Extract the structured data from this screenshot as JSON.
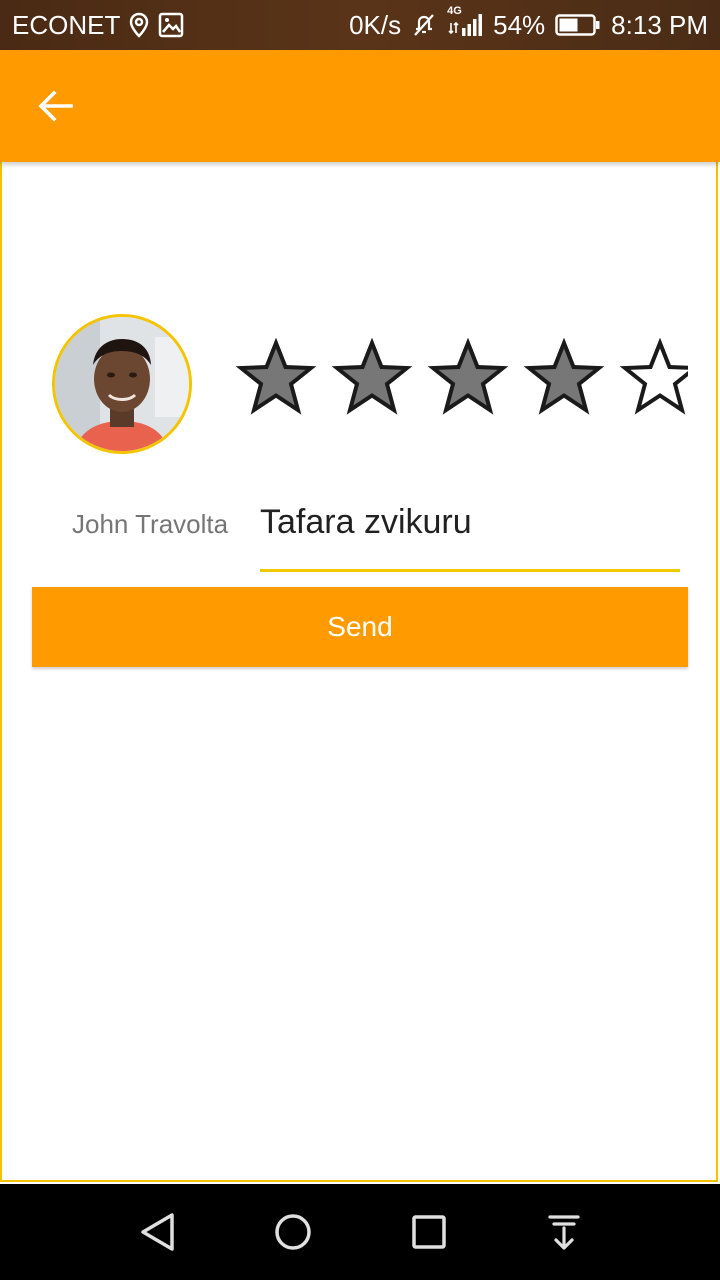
{
  "status_bar": {
    "carrier": "ECONET",
    "network_speed": "0K/s",
    "network_type": "4G",
    "battery": "54%",
    "time": "8:13 PM",
    "icons": [
      "location-icon",
      "image-icon",
      "mute-icon",
      "signal-icon",
      "battery-icon"
    ]
  },
  "app_bar": {
    "back_icon": "arrow-back-icon",
    "color": "#ff9a00"
  },
  "rating": {
    "value": 4,
    "max": 5,
    "filled_color": "#777777",
    "empty_color": "#ffffff"
  },
  "review": {
    "reviewer_name": "John Travolta",
    "message": "Tafara zvikuru",
    "send_label": "Send"
  },
  "nav_bar": {
    "icons": [
      "back-triangle-icon",
      "home-circle-icon",
      "recents-square-icon",
      "notification-pull-icon"
    ]
  }
}
